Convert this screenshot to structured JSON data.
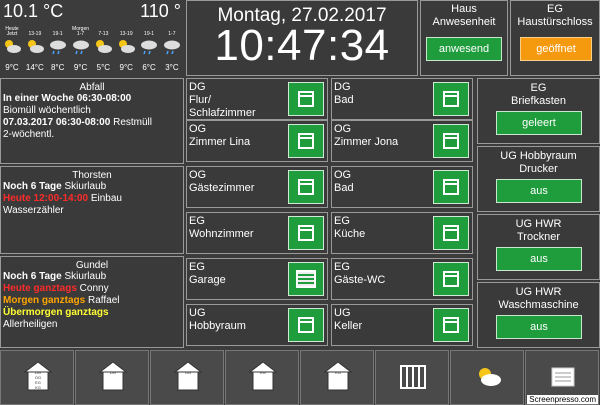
{
  "weather": {
    "temp_now": "10.1 °C",
    "humidity": "110 °",
    "days": [
      "Heute",
      "",
      "",
      "Morgen",
      "",
      "",
      "",
      ""
    ],
    "hours": [
      "Jetzt",
      "13-19",
      "19-1",
      "1-7",
      "7-13",
      "13-19",
      "19-1",
      "1-7"
    ],
    "icons": [
      "sun-cloud-icon",
      "sun-cloud-icon",
      "cloud-rain-icon",
      "cloud-rain-icon",
      "sun-cloud-icon",
      "sun-cloud-icon",
      "cloud-rain-icon",
      "cloud-rain-icon"
    ],
    "temps": [
      "9°C",
      "14°C",
      "8°C",
      "9°C",
      "5°C",
      "9°C",
      "6°C",
      "3°C"
    ]
  },
  "datetime": {
    "date": "Montag, 27.02.2017",
    "time": "10:47:34"
  },
  "status": [
    {
      "title": "Haus\nAnwesenheit",
      "button": "anwesend",
      "color": "#1f9c3c"
    },
    {
      "title": "EG\nHaustürschloss",
      "button": "geöffnet",
      "color": "#f5990f"
    }
  ],
  "abfall": {
    "head": "Abfall",
    "l1": "In einer Woche 06:30-08:00",
    "l2": "Biomüll wöchentlich",
    "l3a": "07.03.2017 06:30-08:00",
    "l3b": " Restmüll",
    "l4": "2-wöchentl."
  },
  "thorsten": {
    "head": "Thorsten",
    "l1a": "Noch 6 Tage",
    "l1b": " Skiurlaub",
    "l2a": "Heute 12:00-14:00",
    "l2b": " Einbau",
    "l3": "Wasserzähler"
  },
  "gundel": {
    "head": "Gundel",
    "l1a": "Noch 6 Tage",
    "l1b": " Skiurlaub",
    "l2a": "Heute ganztags",
    "l2b": " Conny",
    "l3a": "Morgen ganztags",
    "l3b": " Raffael",
    "l4a": "Übermorgen ganztags",
    "l5": "Allerheiligen"
  },
  "rooms": [
    {
      "l1": "DG",
      "l2": "Flur/",
      "l3": "Schlafzimmer",
      "icon": "window-icon"
    },
    {
      "l1": "DG",
      "l2": "Bad",
      "l3": "",
      "icon": "window-icon"
    },
    {
      "l1": "OG",
      "l2": "Zimmer Lina",
      "l3": "",
      "icon": "window-icon"
    },
    {
      "l1": "OG",
      "l2": "Zimmer Jona",
      "l3": "",
      "icon": "window-icon"
    },
    {
      "l1": "OG",
      "l2": "Gästezimmer",
      "l3": "",
      "icon": "window-icon"
    },
    {
      "l1": "OG",
      "l2": "Bad",
      "l3": "",
      "icon": "window-icon"
    },
    {
      "l1": "EG",
      "l2": "Wohnzimmer",
      "l3": "",
      "icon": "window-icon"
    },
    {
      "l1": "EG",
      "l2": "Küche",
      "l3": "",
      "icon": "window-icon"
    },
    {
      "l1": "EG",
      "l2": "Garage",
      "l3": "",
      "icon": "shutter-icon"
    },
    {
      "l1": "EG",
      "l2": "Gäste-WC",
      "l3": "",
      "icon": "window-icon"
    },
    {
      "l1": "UG",
      "l2": "Hobbyraum",
      "l3": "",
      "icon": "window-icon"
    },
    {
      "l1": "UG",
      "l2": "Keller",
      "l3": "",
      "icon": "window-icon"
    }
  ],
  "right_cards": [
    {
      "title": "EG\nBriefkasten",
      "button": "geleert"
    },
    {
      "title": "UG Hobbyraum\nDrucker",
      "button": "aus"
    },
    {
      "title": "UG HWR\nTrockner",
      "button": "aus"
    },
    {
      "title": "UG HWR\nWaschmaschine",
      "button": "aus"
    }
  ],
  "nav": [
    {
      "name": "house-all-floors-icon",
      "labels": [
        "DG",
        "OG",
        "EG",
        "KG"
      ]
    },
    {
      "name": "house-dg-icon",
      "labels": [
        "DG"
      ]
    },
    {
      "name": "house-og-icon",
      "labels": [
        "OG"
      ]
    },
    {
      "name": "house-eg-icon",
      "labels": [
        "EG"
      ]
    },
    {
      "name": "house-kg-icon",
      "labels": [
        "KG"
      ]
    },
    {
      "name": "radiator-icon",
      "labels": []
    },
    {
      "name": "weather-icon",
      "labels": []
    },
    {
      "name": "newspaper-icon",
      "labels": []
    }
  ],
  "watermark": "Screenpresso.com"
}
